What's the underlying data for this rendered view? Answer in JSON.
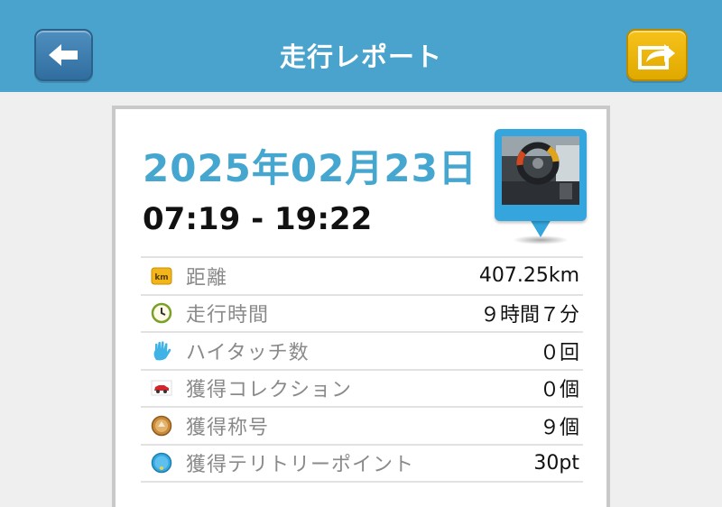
{
  "header": {
    "title": "走行レポート",
    "back_icon": "left-arrow-icon",
    "share_icon": "share-icon",
    "color": "#4aa3cc"
  },
  "report": {
    "date": "2025年02月23日",
    "time_range": "07:19 - 19:22",
    "photo_icon": "car-interior-photo"
  },
  "stats": [
    {
      "icon": "km-icon",
      "label": "距離",
      "value": "407.25km"
    },
    {
      "icon": "clock-icon",
      "label": "走行時間",
      "value": "９時間７分"
    },
    {
      "icon": "hand-icon",
      "label": "ハイタッチ数",
      "value": "０回"
    },
    {
      "icon": "car-icon",
      "label": "獲得コレクション",
      "value": "０個"
    },
    {
      "icon": "medal-icon",
      "label": "獲得称号",
      "value": "９個"
    },
    {
      "icon": "spot-icon",
      "label": "獲得テリトリーポイント",
      "value": "30pt"
    }
  ]
}
